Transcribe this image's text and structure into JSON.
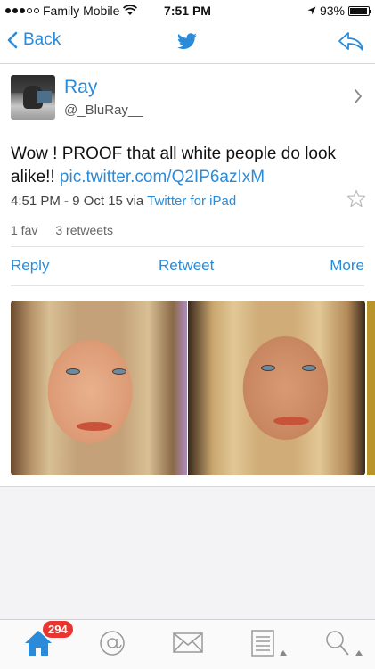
{
  "status_bar": {
    "carrier": "Family Mobile",
    "time": "7:51 PM",
    "battery": "93%",
    "battery_level": 0.93
  },
  "nav": {
    "back_label": "Back"
  },
  "tweet": {
    "user_name": "Ray",
    "user_handle": "@_BluRay__",
    "text": "Wow ! PROOF that all white people do look alike!! ",
    "link": "pic.twitter.com/Q2IP6azIxM",
    "timestamp": "4:51 PM - 9 Oct 15",
    "via_prefix": "via",
    "via_app": "Twitter for iPad",
    "favs": "1 fav",
    "retweets": "3 retweets"
  },
  "actions": {
    "reply": "Reply",
    "retweet": "Retweet",
    "more": "More"
  },
  "tab_bar": {
    "home_badge": "294"
  },
  "colors": {
    "accent": "#2b8bd8",
    "badge": "#e8352f"
  }
}
